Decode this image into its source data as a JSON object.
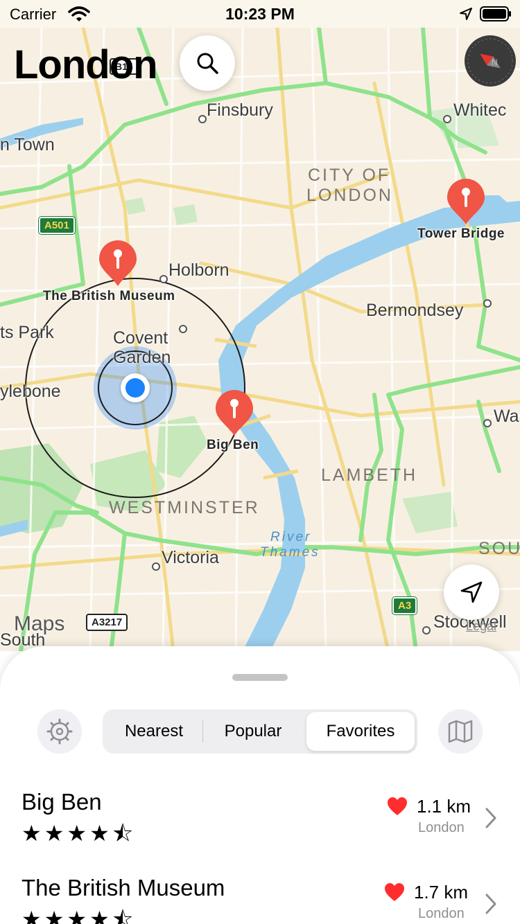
{
  "status_bar": {
    "carrier": "Carrier",
    "time": "10:23 PM"
  },
  "header": {
    "title": "London"
  },
  "map": {
    "area_labels": {
      "city_line1": "CITY OF",
      "city_line2": "LONDON",
      "lambeth": "LAMBETH",
      "westminster": "WESTMINSTER"
    },
    "place_labels": {
      "finsbury": "Finsbury",
      "whitechapel": "Whitec",
      "camden_town": "n Town",
      "holborn": "Holborn",
      "regents_park": "ts Park",
      "covent_garden_1": "Covent",
      "covent_garden_2": "Garden",
      "marylebone": "ylebone",
      "bermondsey": "Bermondsey",
      "walworth": "Wa",
      "victoria": "Victoria",
      "southwark": "SOU",
      "stockwell": "Stockwell",
      "south": "South"
    },
    "river_label_1": "River",
    "river_label_2": "Thames",
    "road_shields": {
      "a501": "A501",
      "a3217": "A3217",
      "a3": "A3",
      "b15": "B15"
    },
    "pins": [
      {
        "name": "The British Museum"
      },
      {
        "name": "Big Ben"
      },
      {
        "name": "Tower Bridge"
      }
    ],
    "attribution": "Maps",
    "legal": "Legal"
  },
  "colors": {
    "pin": "#f05545",
    "user_location": "#1a82fb",
    "park_road": "#7fe07f",
    "river": "#8ec9ee",
    "heart": "#ff2d2d"
  },
  "sheet": {
    "segments": [
      "Nearest",
      "Popular",
      "Favorites"
    ],
    "selected_segment": "Favorites",
    "items": [
      {
        "title": "Big Ben",
        "stars": "★★★★⯪",
        "rating": 4.5,
        "favorite": true,
        "distance": "1.1 km",
        "city": "London"
      },
      {
        "title": "The British Museum",
        "stars": "★★★★⯪",
        "rating": 4.5,
        "favorite": true,
        "distance": "1.7 km",
        "city": "London"
      }
    ]
  },
  "icons": [
    "wifi-icon",
    "location-arrow-icon",
    "battery-icon",
    "search-icon",
    "compass-icon",
    "navigation-arrow-icon",
    "gear-icon",
    "map-icon",
    "heart-icon",
    "chevron-right-icon",
    "map-pin-icon"
  ]
}
